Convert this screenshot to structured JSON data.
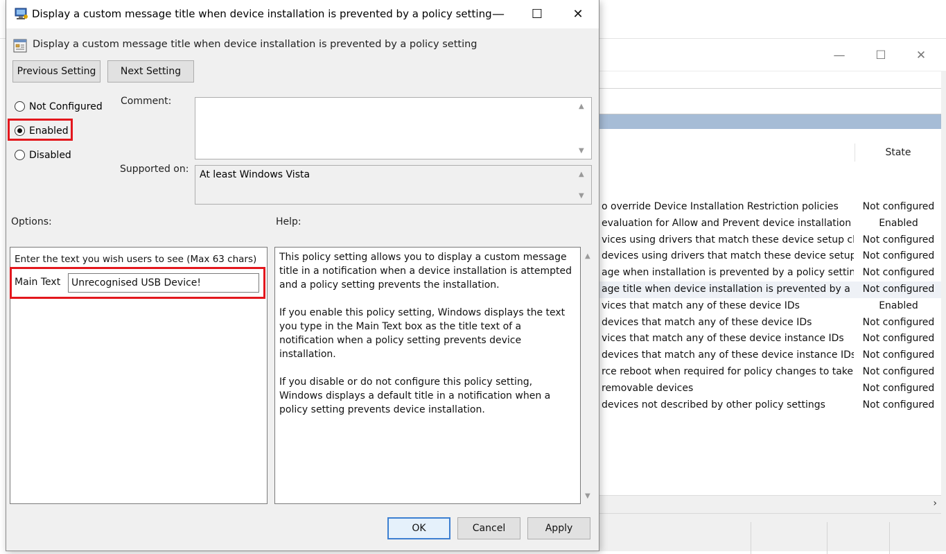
{
  "dialog": {
    "title": "Display a custom message title when device installation is prevented by a policy setting",
    "header": "Display a custom message title when device installation is prevented by a policy setting",
    "window_controls": {
      "minimize": "—",
      "maximize": "☐",
      "close": "✕"
    },
    "nav": {
      "previous": "Previous Setting",
      "next": "Next Setting"
    },
    "state_options": [
      {
        "label": "Not Configured",
        "checked": false
      },
      {
        "label": "Enabled",
        "checked": true
      },
      {
        "label": "Disabled",
        "checked": false
      }
    ],
    "comment_label": "Comment:",
    "comment_value": "",
    "supported_label": "Supported on:",
    "supported_value": "At least Windows Vista",
    "options_label": "Options:",
    "help_label": "Help:",
    "options_instruction": "Enter the text you wish users to see (Max 63 chars)",
    "main_text_label": "Main Text",
    "main_text_value": "Unrecognised USB Device!",
    "help_paragraphs": [
      "This policy setting allows you to display a custom message title in a notification when a device installation is attempted and a policy setting prevents the installation.",
      "If you enable this policy setting, Windows displays the text you type in the Main Text box as the title text of a notification when a policy setting prevents device installation.",
      "If you disable or do not configure this policy setting, Windows displays a default title in a notification when a policy setting prevents device installation."
    ],
    "buttons": {
      "ok": "OK",
      "cancel": "Cancel",
      "apply": "Apply"
    },
    "highlight_color": "#e3171d"
  },
  "background_window": {
    "window_controls": {
      "minimize": "—",
      "maximize": "☐",
      "close": "✕"
    },
    "state_header": "State",
    "rows": [
      {
        "setting": "o override Device Installation Restriction policies",
        "state": "Not configured"
      },
      {
        "setting": "evaluation for Allow and Prevent device installation pol...",
        "state": "Enabled"
      },
      {
        "setting": "vices using drivers that match these device setup classes",
        "state": "Not configured"
      },
      {
        "setting": "devices using drivers that match these device setup clas...",
        "state": "Not configured"
      },
      {
        "setting": "age when installation is prevented by a policy setting",
        "state": "Not configured"
      },
      {
        "setting": "age title when device installation is prevented by a poli...",
        "state": "Not configured"
      },
      {
        "setting": "vices that match any of these device IDs",
        "state": "Enabled"
      },
      {
        "setting": "devices that match any of these device IDs",
        "state": "Not configured"
      },
      {
        "setting": "vices that match any of these device instance IDs",
        "state": "Not configured"
      },
      {
        "setting": "devices that match any of these device instance IDs",
        "state": "Not configured"
      },
      {
        "setting": "rce reboot when required for policy changes to take eff...",
        "state": "Not configured"
      },
      {
        "setting": "removable devices",
        "state": "Not configured"
      },
      {
        "setting": "devices not described by other policy settings",
        "state": "Not configured"
      }
    ],
    "selected_row": 5,
    "hscroll_arrow": "›"
  }
}
